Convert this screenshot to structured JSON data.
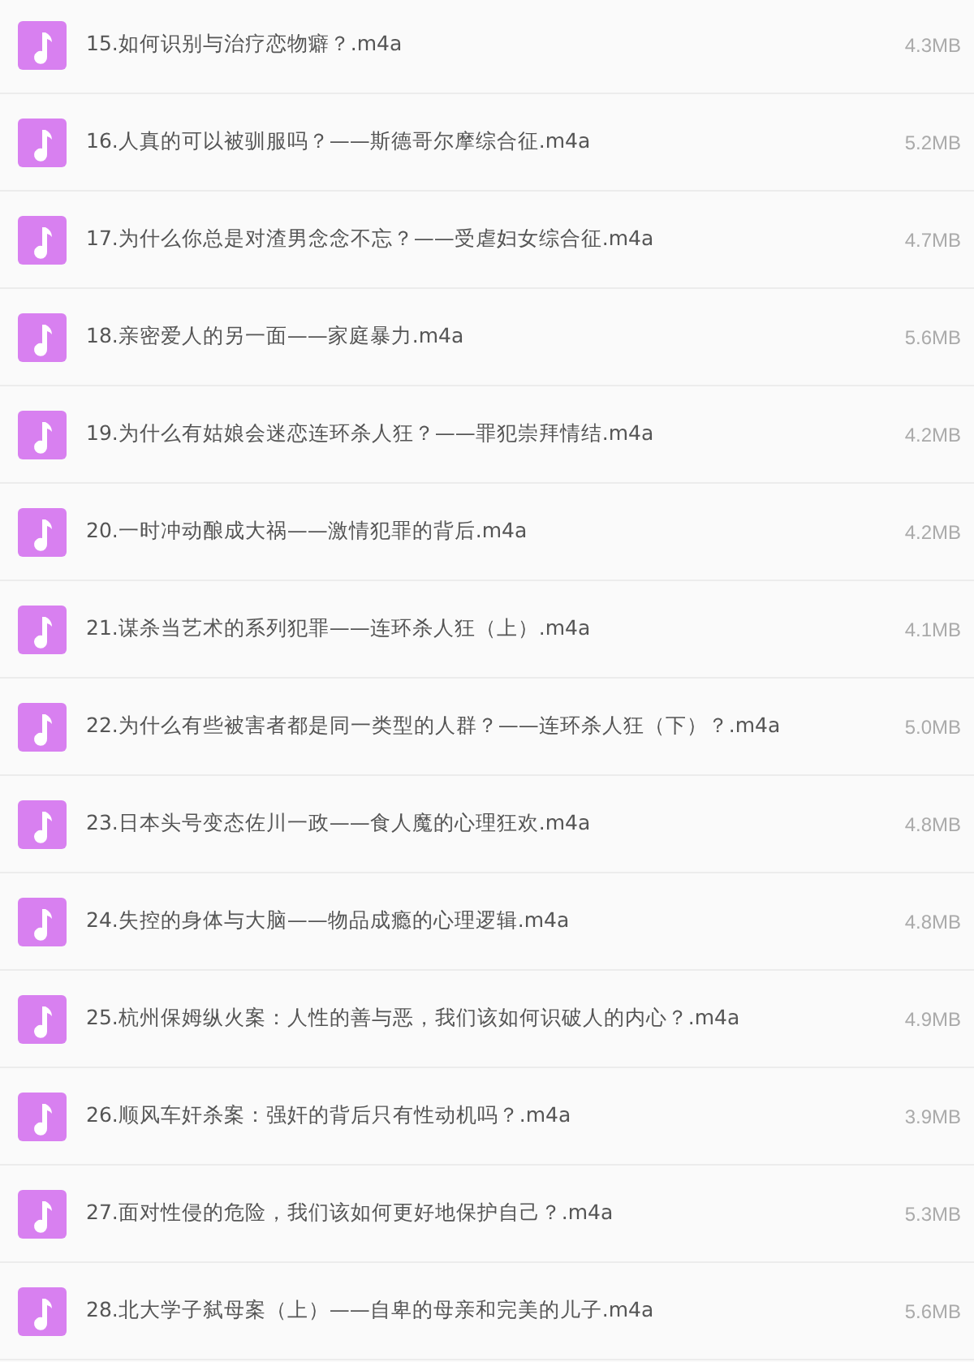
{
  "files": [
    {
      "name": "15.如何识别与治疗恋物癖？.m4a",
      "size": "4.3MB"
    },
    {
      "name": "16.人真的可以被驯服吗？——斯德哥尔摩综合征.m4a",
      "size": "5.2MB"
    },
    {
      "name": "17.为什么你总是对渣男念念不忘？——受虐妇女综合征.m4a",
      "size": "4.7MB"
    },
    {
      "name": "18.亲密爱人的另一面——家庭暴力.m4a",
      "size": "5.6MB"
    },
    {
      "name": "19.为什么有姑娘会迷恋连环杀人狂？——罪犯崇拜情结.m4a",
      "size": "4.2MB"
    },
    {
      "name": "20.一时冲动酿成大祸——激情犯罪的背后.m4a",
      "size": "4.2MB"
    },
    {
      "name": "21.谋杀当艺术的系列犯罪——连环杀人狂（上）.m4a",
      "size": "4.1MB"
    },
    {
      "name": "22.为什么有些被害者都是同一类型的人群？——连环杀人狂（下）？.m4a",
      "size": "5.0MB"
    },
    {
      "name": "23.日本头号变态佐川一政——食人魔的心理狂欢.m4a",
      "size": "4.8MB"
    },
    {
      "name": "24.失控的身体与大脑——物品成瘾的心理逻辑.m4a",
      "size": "4.8MB"
    },
    {
      "name": "25.杭州保姆纵火案：人性的善与恶，我们该如何识破人的内心？.m4a",
      "size": "4.9MB"
    },
    {
      "name": "26.顺风车奸杀案：强奸的背后只有性动机吗？.m4a",
      "size": "3.9MB"
    },
    {
      "name": "27.面对性侵的危险，我们该如何更好地保护自己？.m4a",
      "size": "5.3MB"
    },
    {
      "name": "28.北大学子弑母案（上）——自卑的母亲和完美的儿子.m4a",
      "size": "5.6MB"
    }
  ]
}
